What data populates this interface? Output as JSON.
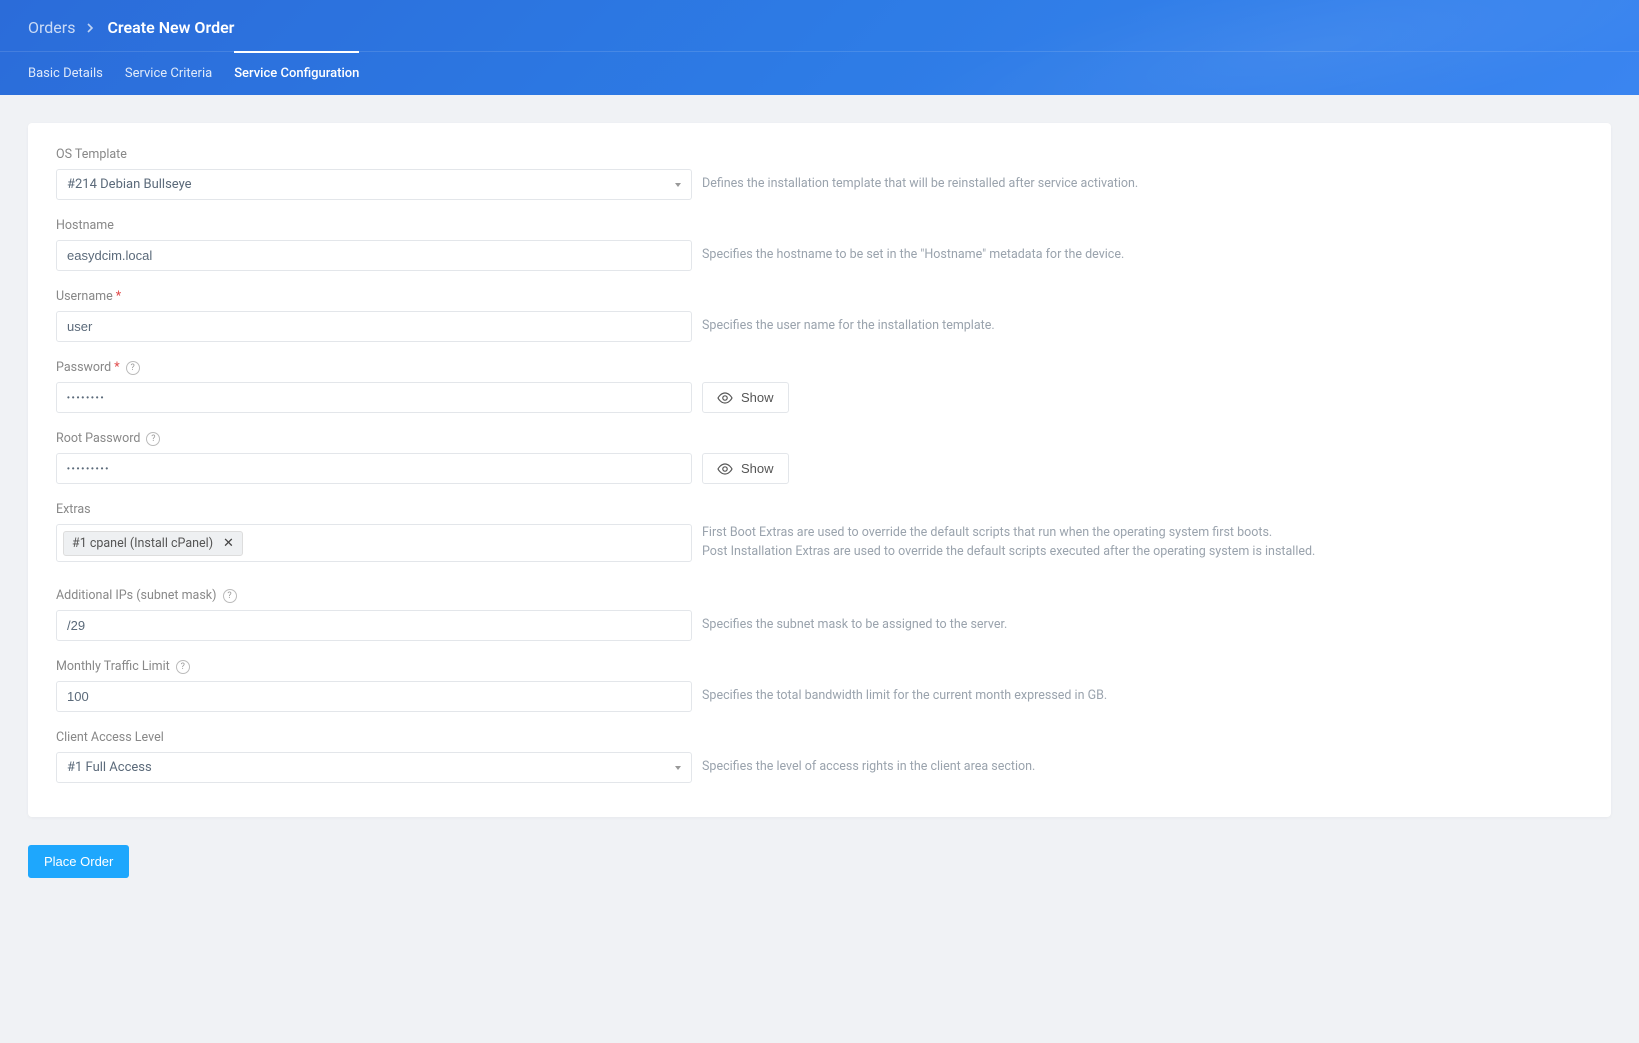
{
  "breadcrumb": {
    "root": "Orders",
    "current": "Create New Order"
  },
  "tabs": [
    {
      "label": "Basic Details",
      "active": false
    },
    {
      "label": "Service Criteria",
      "active": false
    },
    {
      "label": "Service Configuration",
      "active": true
    }
  ],
  "fields": {
    "os_template": {
      "label": "OS Template",
      "value": "#214 Debian Bullseye",
      "desc": "Defines the installation template that will be reinstalled after service activation."
    },
    "hostname": {
      "label": "Hostname",
      "value": "easydcim.local",
      "desc": "Specifies the hostname to be set in the \"Hostname\" metadata for the device."
    },
    "username": {
      "label": "Username",
      "value": "user",
      "desc": "Specifies the user name for the installation template."
    },
    "password": {
      "label": "Password",
      "value": "••••••••",
      "show_label": "Show"
    },
    "root_password": {
      "label": "Root Password",
      "value": "•••••••••",
      "show_label": "Show"
    },
    "extras": {
      "label": "Extras",
      "tag": "#1 cpanel (Install cPanel)",
      "desc_line1": "First Boot Extras are used to override the default scripts that run when the operating system first boots.",
      "desc_line2": "Post Installation Extras are used to override the default scripts executed after the operating system is installed."
    },
    "additional_ips": {
      "label": "Additional IPs (subnet mask)",
      "value": "/29",
      "desc": "Specifies the subnet mask to be assigned to the server."
    },
    "traffic": {
      "label": "Monthly Traffic Limit",
      "value": "100",
      "desc": "Specifies the total bandwidth limit for the current month expressed in GB."
    },
    "access_level": {
      "label": "Client Access Level",
      "value": "#1 Full Access",
      "desc": "Specifies the level of access rights in the client area section."
    }
  },
  "actions": {
    "place_order": "Place Order"
  }
}
